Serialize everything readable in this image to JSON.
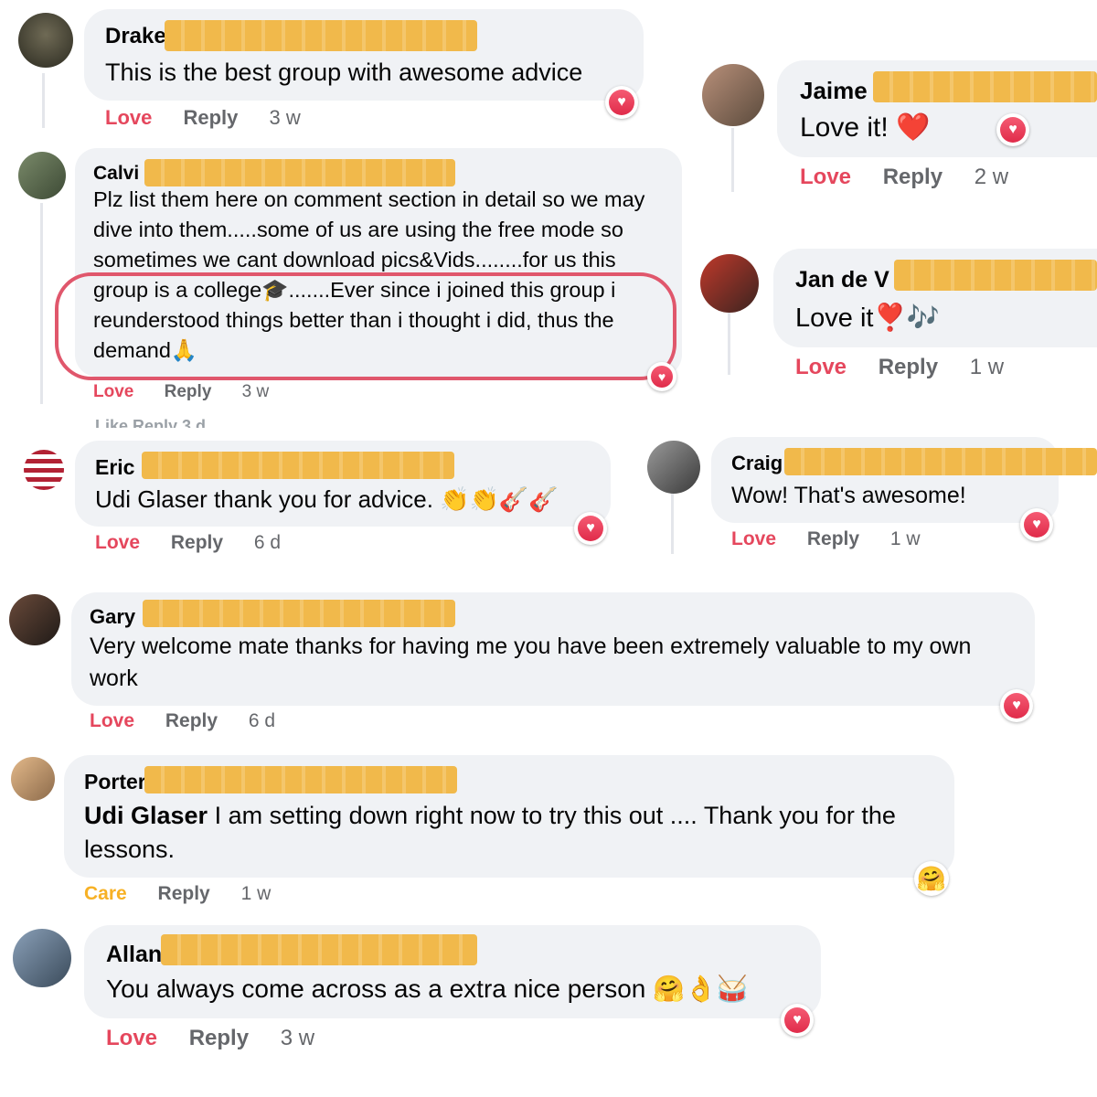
{
  "reactions": {
    "love": "Love",
    "care": "Care",
    "reply": "Reply"
  },
  "colors": {
    "love": "#e5475d",
    "care": "#f7b125",
    "bubble": "#f0f2f5",
    "redaction": "#f1b94b",
    "highlight": "#e0576c"
  },
  "comments": [
    {
      "name": "Drake",
      "text": "This is the best group with awesome advice",
      "reaction": "Love",
      "time": "3 w",
      "badge": "heart"
    },
    {
      "name": "Jaime",
      "text": "Love it! ❤️",
      "reaction": "Love",
      "time": "2 w",
      "badge": "heart"
    },
    {
      "name": "Calvi",
      "text": "Plz list them here on comment section in detail so we may dive into them.....some of us are using the free mode so sometimes we cant download pics&Vids........for us this group is a college🎓.......Ever since i joined this group i reunderstood things better than i thought i did, thus the demand🙏",
      "reaction": "Love",
      "time": "3 w",
      "badge": "heart"
    },
    {
      "name": "Jan de V",
      "text": "Love it❣️🎶",
      "reaction": "Love",
      "time": "1 w",
      "badge": "heart"
    },
    {
      "name": "Eric",
      "text": "Udi Glaser thank you for advice. 👏👏🎸🎸",
      "reaction": "Love",
      "time": "6 d",
      "badge": "heart"
    },
    {
      "name": "Craig",
      "text": "Wow! That's awesome!",
      "reaction": "Love",
      "time": "1 w",
      "badge": "heart"
    },
    {
      "name": "Gary",
      "text": "Very welcome mate thanks for having me you have been extremely valuable to my own work",
      "reaction": "Love",
      "time": "6 d",
      "badge": "heart"
    },
    {
      "name": "Porter",
      "mention": "Udi Glaser",
      "text": " I am setting down right now to try this out .... Thank you for the lessons.",
      "reaction": "Care",
      "time": "1 w",
      "badge": "care"
    },
    {
      "name": "Allan",
      "text": "You always come across as a extra nice person 🤗👌🥁",
      "reaction": "Love",
      "time": "3 w",
      "badge": "heart"
    }
  ],
  "ghost_rows": {
    "calvi_below": "Like  Reply  3 d"
  },
  "icons": {
    "heart_react": "heart-icon",
    "care_react": "care-icon"
  }
}
